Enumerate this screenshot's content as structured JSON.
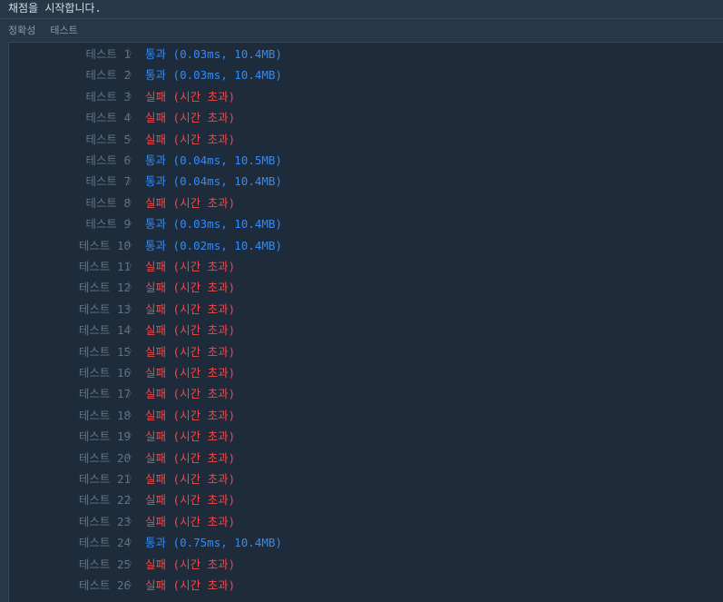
{
  "header": {
    "message": "채점을 시작합니다."
  },
  "tabs": [
    {
      "label": "정확성"
    },
    {
      "label": "테스트"
    }
  ],
  "colors": {
    "pass": "#2f8cff",
    "fail": "#f04a4a",
    "label": "#5f7587",
    "background": "#1e2b3a"
  },
  "tests": [
    {
      "label": "테스트 1",
      "chevron": "〉",
      "status": "통과",
      "detail": "(0.03ms, 10.4MB)",
      "result": "pass"
    },
    {
      "label": "테스트 2",
      "chevron": "〉",
      "status": "통과",
      "detail": "(0.03ms, 10.4MB)",
      "result": "pass"
    },
    {
      "label": "테스트 3",
      "chevron": "〉",
      "status": "실패",
      "detail": "(시간 초과)",
      "result": "fail"
    },
    {
      "label": "테스트 4",
      "chevron": "〉",
      "status": "실패",
      "detail": "(시간 초과)",
      "result": "fail"
    },
    {
      "label": "테스트 5",
      "chevron": "〉",
      "status": "실패",
      "detail": "(시간 초과)",
      "result": "fail"
    },
    {
      "label": "테스트 6",
      "chevron": "〉",
      "status": "통과",
      "detail": "(0.04ms, 10.5MB)",
      "result": "pass"
    },
    {
      "label": "테스트 7",
      "chevron": "〉",
      "status": "통과",
      "detail": "(0.04ms, 10.4MB)",
      "result": "pass"
    },
    {
      "label": "테스트 8",
      "chevron": "〉",
      "status": "실패",
      "detail": "(시간 초과)",
      "result": "fail"
    },
    {
      "label": "테스트 9",
      "chevron": "〉",
      "status": "통과",
      "detail": "(0.03ms, 10.4MB)",
      "result": "pass"
    },
    {
      "label": "테스트 10",
      "chevron": "〉",
      "status": "통과",
      "detail": "(0.02ms, 10.4MB)",
      "result": "pass"
    },
    {
      "label": "테스트 11",
      "chevron": "〉",
      "status": "실패",
      "detail": "(시간 초과)",
      "result": "fail"
    },
    {
      "label": "테스트 12",
      "chevron": "〉",
      "status": "실패",
      "detail": "(시간 초과)",
      "result": "fail"
    },
    {
      "label": "테스트 13",
      "chevron": "〉",
      "status": "실패",
      "detail": "(시간 초과)",
      "result": "fail"
    },
    {
      "label": "테스트 14",
      "chevron": "〉",
      "status": "실패",
      "detail": "(시간 초과)",
      "result": "fail"
    },
    {
      "label": "테스트 15",
      "chevron": "〉",
      "status": "실패",
      "detail": "(시간 초과)",
      "result": "fail"
    },
    {
      "label": "테스트 16",
      "chevron": "〉",
      "status": "실패",
      "detail": "(시간 초과)",
      "result": "fail"
    },
    {
      "label": "테스트 17",
      "chevron": "〉",
      "status": "실패",
      "detail": "(시간 초과)",
      "result": "fail"
    },
    {
      "label": "테스트 18",
      "chevron": "〉",
      "status": "실패",
      "detail": "(시간 초과)",
      "result": "fail"
    },
    {
      "label": "테스트 19",
      "chevron": "〉",
      "status": "실패",
      "detail": "(시간 초과)",
      "result": "fail"
    },
    {
      "label": "테스트 20",
      "chevron": "〉",
      "status": "실패",
      "detail": "(시간 초과)",
      "result": "fail"
    },
    {
      "label": "테스트 21",
      "chevron": "〉",
      "status": "실패",
      "detail": "(시간 초과)",
      "result": "fail"
    },
    {
      "label": "테스트 22",
      "chevron": "〉",
      "status": "실패",
      "detail": "(시간 초과)",
      "result": "fail"
    },
    {
      "label": "테스트 23",
      "chevron": "〉",
      "status": "실패",
      "detail": "(시간 초과)",
      "result": "fail"
    },
    {
      "label": "테스트 24",
      "chevron": "〉",
      "status": "통과",
      "detail": "(0.75ms, 10.4MB)",
      "result": "pass"
    },
    {
      "label": "테스트 25",
      "chevron": "〉",
      "status": "실패",
      "detail": "(시간 초과)",
      "result": "fail"
    },
    {
      "label": "테스트 26",
      "chevron": "〉",
      "status": "실패",
      "detail": "(시간 초과)",
      "result": "fail"
    }
  ]
}
